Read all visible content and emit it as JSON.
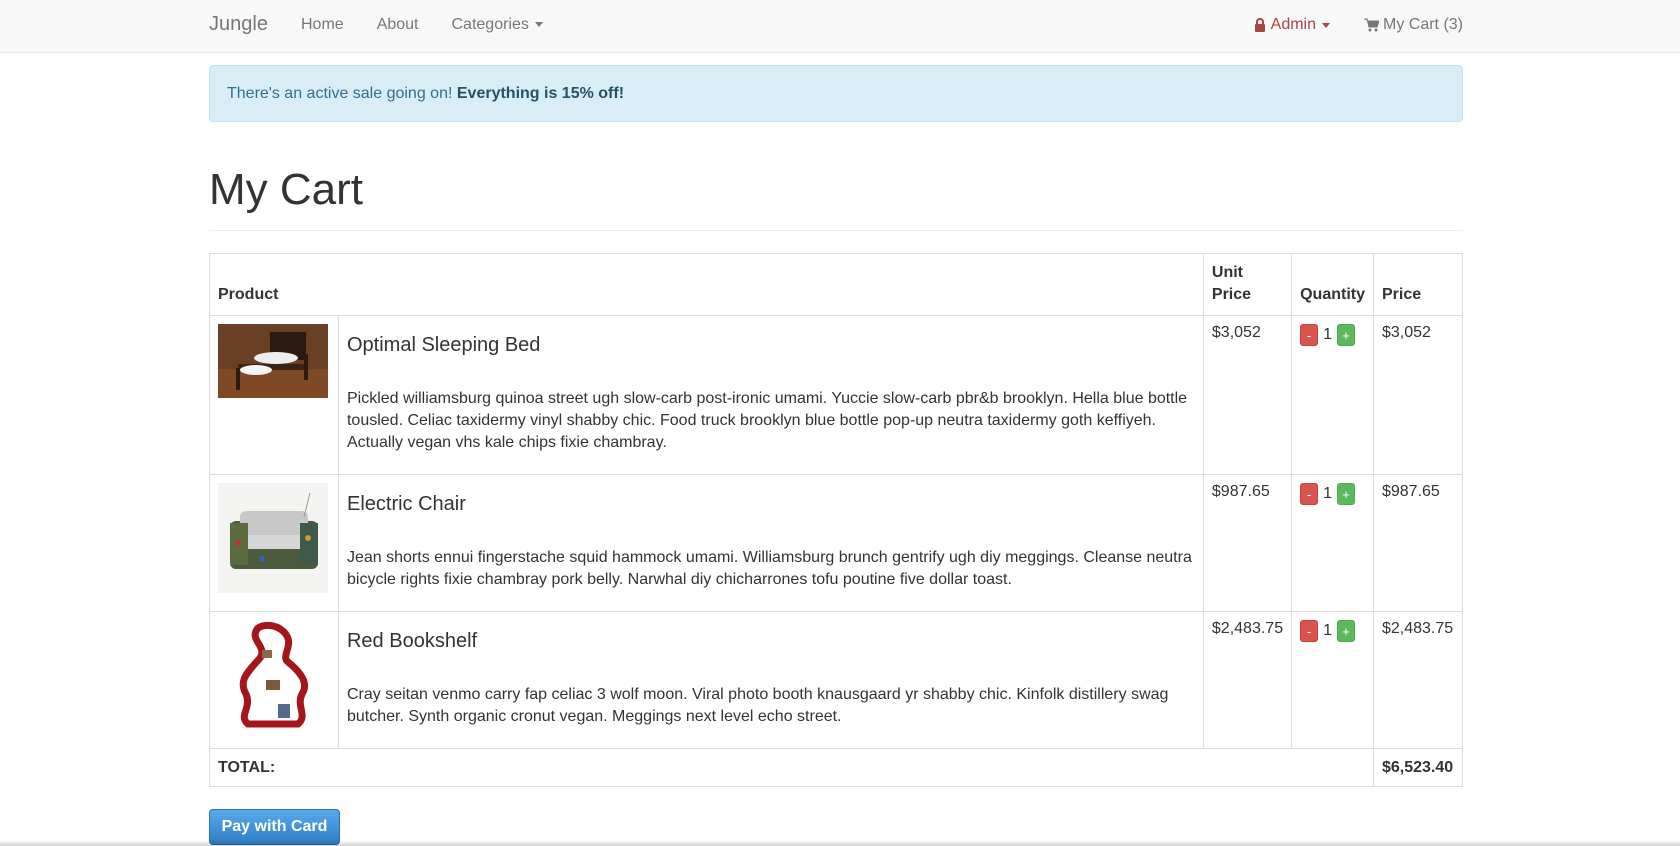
{
  "navbar": {
    "brand": "Jungle",
    "links": [
      "Home",
      "About",
      "Categories"
    ],
    "admin_label": "Admin",
    "cart_label": "My Cart (3)"
  },
  "alert": {
    "text": "There's an active sale going on!",
    "bold": "Everything is 15% off!"
  },
  "page": {
    "title": "My Cart"
  },
  "table": {
    "headers": {
      "product": "Product",
      "unit_price": "Unit Price",
      "quantity": "Quantity",
      "price": "Price"
    },
    "items": [
      {
        "name": "Optimal Sleeping Bed",
        "description": "Pickled williamsburg quinoa street ugh slow-carb post-ironic umami. Yuccie slow-carb pbr&b brooklyn. Hella blue bottle tousled. Celiac taxidermy vinyl shabby chic. Food truck brooklyn blue bottle pop-up neutra taxidermy goth keffiyeh. Actually vegan vhs kale chips fixie chambray.",
        "unit_price": "$3,052",
        "quantity": "1",
        "price": "$3,052"
      },
      {
        "name": "Electric Chair",
        "description": "Jean shorts ennui fingerstache squid hammock umami. Williamsburg brunch gentrify ugh diy meggings. Cleanse neutra bicycle rights fixie chambray pork belly. Narwhal diy chicharrones tofu poutine five dollar toast.",
        "unit_price": "$987.65",
        "quantity": "1",
        "price": "$987.65"
      },
      {
        "name": "Red Bookshelf",
        "description": "Cray seitan venmo carry fap celiac 3 wolf moon. Viral photo booth knausgaard yr shabby chic. Kinfolk distillery swag butcher. Synth organic cronut vegan. Meggings next level echo street.",
        "unit_price": "$2,483.75",
        "quantity": "1",
        "price": "$2,483.75"
      }
    ],
    "buttons": {
      "minus": "-",
      "plus": "+"
    },
    "total_label": "TOTAL:",
    "total_value": "$6,523.40"
  },
  "pay_button": "Pay with Card",
  "colors": {
    "alert_bg": "#d9edf7",
    "admin": "#a94442",
    "minus": "#d9534f",
    "plus": "#5cb85c",
    "pay": "#2d7ec4"
  }
}
